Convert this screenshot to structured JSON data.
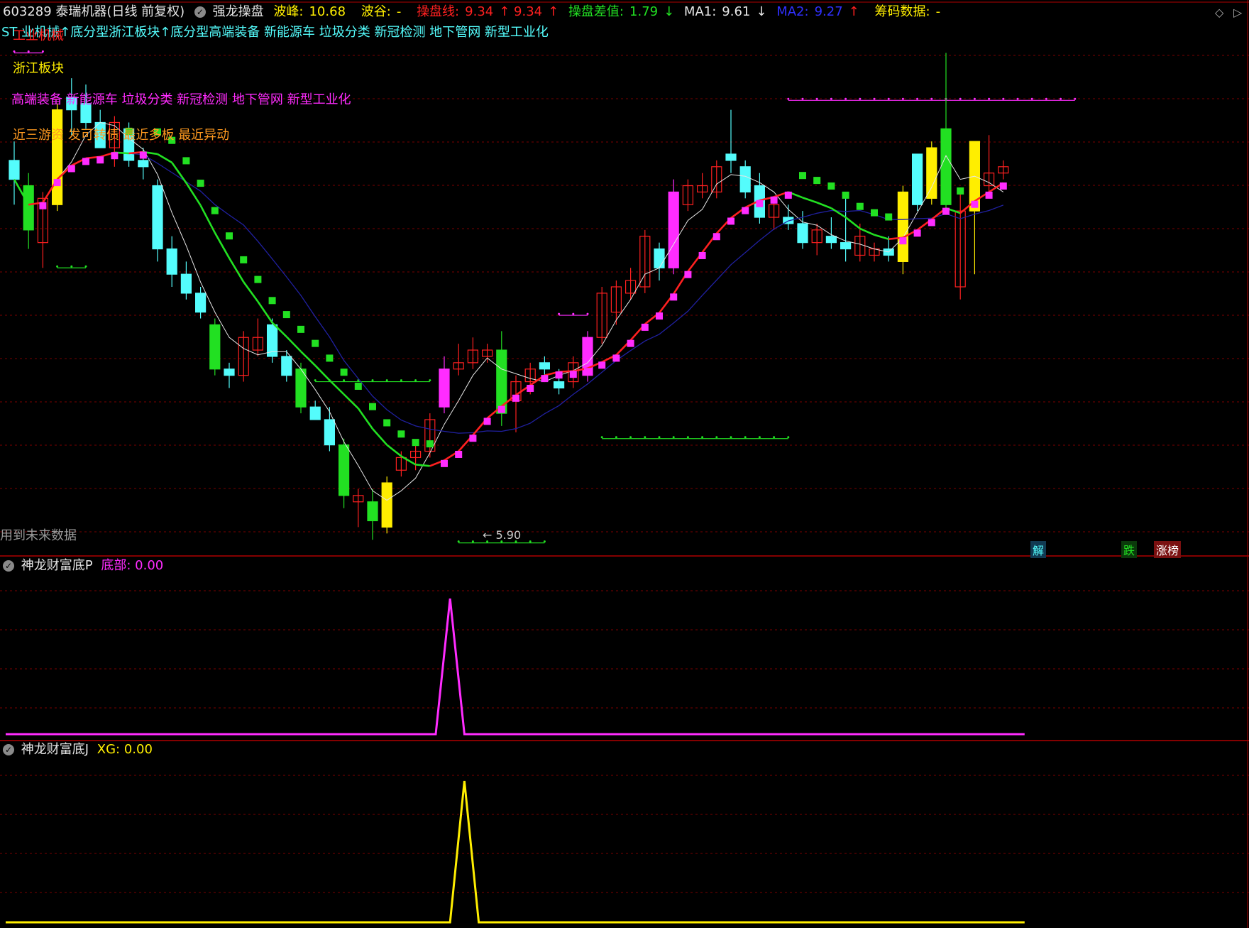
{
  "colors": {
    "bg": "#000000",
    "grid": "#7a0000",
    "divider": "#b00000",
    "cyan": "#54fcfc",
    "green": "#22e022",
    "yellow": "#ffee00",
    "magenta": "#ff2cff",
    "red": "#ff2020",
    "blue": "#2020a0",
    "white": "#e6e6e6",
    "text": "#cccccc"
  },
  "header": {
    "stock": "603289 泰瑞机器(日线 前复权)",
    "indicator": "强龙操盘",
    "peak_label": "波峰:",
    "peak_value": "10.68",
    "trough_label": "波谷:",
    "trough_value": "-",
    "cpx_label": "操盘线:",
    "cpx_value1": "9.34",
    "cpx_value2": "9.34",
    "cpcz_label": "操盘差值:",
    "cpcz_value": "1.79",
    "ma1_label": "MA1:",
    "ma1_value": "9.61",
    "ma2_label": "MA2:",
    "ma2_value": "9.27",
    "chip_label": "筹码数据:",
    "chip_value": "-"
  },
  "concept_line": "ST  业机械↑底分型浙江板块↑底分型高端装备 新能源车 垃圾分类 新冠检测 地下管网 新型工业化",
  "chart_labels": {
    "tag_industry": "工业机械",
    "tag_region": "浙江板块",
    "tag_concepts": "高端装备 新能源车 垃圾分类 新冠检测 地下管网 新型工业化",
    "tag_recent": "近三游资 发可转债 最近多板 最近异动",
    "low_marker": "← 5.90",
    "future_warning": "用到未来数据",
    "marker_jie": "解",
    "marker_die": "跌",
    "marker_zhangbang": "涨榜"
  },
  "panel2": {
    "title": "神龙财富底P",
    "field_label": "底部:",
    "field_value": "0.00"
  },
  "panel3": {
    "title": "神龙财富底J",
    "field_label": "XG:",
    "field_value": "0.00"
  },
  "icons": [
    "collapse-icon",
    "diamond-icon",
    "scroll-right-icon"
  ],
  "chart_data": [
    {
      "type": "candlestick",
      "title": "强龙操盘",
      "candles": [
        {
          "o": 10.0,
          "h": 10.3,
          "l": 9.3,
          "c": 9.7,
          "color": "cyan"
        },
        {
          "o": 9.6,
          "h": 9.8,
          "l": 8.6,
          "c": 8.9,
          "color": "green"
        },
        {
          "o": 8.7,
          "h": 9.5,
          "l": 8.3,
          "c": 9.4,
          "color": "red"
        },
        {
          "o": 9.3,
          "h": 10.9,
          "l": 9.2,
          "c": 10.8,
          "color": "yellow"
        },
        {
          "o": 11.0,
          "h": 11.3,
          "l": 10.4,
          "c": 10.8,
          "color": "cyan"
        },
        {
          "o": 10.9,
          "h": 11.2,
          "l": 10.5,
          "c": 10.6,
          "color": "cyan"
        },
        {
          "o": 10.6,
          "h": 10.8,
          "l": 10.2,
          "c": 10.2,
          "color": "cyan"
        },
        {
          "o": 10.2,
          "h": 10.7,
          "l": 9.9,
          "c": 10.6,
          "color": "red"
        },
        {
          "o": 10.5,
          "h": 10.6,
          "l": 9.9,
          "c": 10.0,
          "color": "cyan"
        },
        {
          "o": 10.0,
          "h": 10.2,
          "l": 9.7,
          "c": 9.9,
          "color": "cyan"
        },
        {
          "o": 9.6,
          "h": 9.7,
          "l": 8.4,
          "c": 8.6,
          "color": "cyan"
        },
        {
          "o": 8.6,
          "h": 8.8,
          "l": 8.0,
          "c": 8.2,
          "color": "cyan"
        },
        {
          "o": 8.2,
          "h": 8.4,
          "l": 7.8,
          "c": 7.9,
          "color": "cyan"
        },
        {
          "o": 7.9,
          "h": 8.0,
          "l": 7.5,
          "c": 7.6,
          "color": "cyan"
        },
        {
          "o": 7.4,
          "h": 7.5,
          "l": 6.6,
          "c": 6.7,
          "color": "green"
        },
        {
          "o": 6.7,
          "h": 6.8,
          "l": 6.4,
          "c": 6.6,
          "color": "cyan"
        },
        {
          "o": 6.6,
          "h": 7.3,
          "l": 6.5,
          "c": 7.2,
          "color": "red"
        },
        {
          "o": 7.0,
          "h": 7.5,
          "l": 6.9,
          "c": 7.2,
          "color": "red"
        },
        {
          "o": 7.4,
          "h": 7.5,
          "l": 6.8,
          "c": 6.9,
          "color": "cyan"
        },
        {
          "o": 6.9,
          "h": 7.0,
          "l": 6.5,
          "c": 6.6,
          "color": "cyan"
        },
        {
          "o": 6.7,
          "h": 6.8,
          "l": 6.0,
          "c": 6.1,
          "color": "green"
        },
        {
          "o": 6.1,
          "h": 6.2,
          "l": 5.9,
          "c": 5.9,
          "color": "cyan"
        },
        {
          "o": 5.9,
          "h": 6.1,
          "l": 5.4,
          "c": 5.5,
          "color": "cyan"
        },
        {
          "o": 5.5,
          "h": 5.6,
          "l": 4.5,
          "c": 4.7,
          "color": "green"
        },
        {
          "o": 4.7,
          "h": 4.8,
          "l": 4.2,
          "c": 4.6,
          "color": "red"
        },
        {
          "o": 4.6,
          "h": 4.8,
          "l": 4.0,
          "c": 4.3,
          "color": "green"
        },
        {
          "o": 4.2,
          "h": 5.0,
          "l": 4.1,
          "c": 4.9,
          "color": "yellow"
        },
        {
          "o": 5.1,
          "h": 5.4,
          "l": 5.0,
          "c": 5.3,
          "color": "red"
        },
        {
          "o": 5.3,
          "h": 5.5,
          "l": 5.1,
          "c": 5.4,
          "color": "red"
        },
        {
          "o": 5.4,
          "h": 6.0,
          "l": 5.3,
          "c": 5.9,
          "color": "red"
        },
        {
          "o": 6.1,
          "h": 6.9,
          "l": 6.0,
          "c": 6.7,
          "color": "magenta"
        },
        {
          "o": 6.7,
          "h": 7.1,
          "l": 6.6,
          "c": 6.8,
          "color": "red"
        },
        {
          "o": 6.8,
          "h": 7.2,
          "l": 6.7,
          "c": 7.0,
          "color": "red"
        },
        {
          "o": 6.9,
          "h": 7.1,
          "l": 6.8,
          "c": 7.0,
          "color": "red"
        },
        {
          "o": 7.0,
          "h": 7.3,
          "l": 5.8,
          "c": 6.0,
          "color": "green"
        },
        {
          "o": 6.2,
          "h": 6.6,
          "l": 5.7,
          "c": 6.5,
          "color": "red"
        },
        {
          "o": 6.5,
          "h": 6.8,
          "l": 6.3,
          "c": 6.7,
          "color": "red"
        },
        {
          "o": 6.7,
          "h": 6.9,
          "l": 6.5,
          "c": 6.8,
          "color": "cyan"
        },
        {
          "o": 6.5,
          "h": 6.7,
          "l": 6.3,
          "c": 6.4,
          "color": "cyan"
        },
        {
          "o": 6.5,
          "h": 6.9,
          "l": 6.4,
          "c": 6.8,
          "color": "red"
        },
        {
          "o": 6.6,
          "h": 7.3,
          "l": 6.5,
          "c": 7.2,
          "color": "magenta"
        },
        {
          "o": 7.2,
          "h": 8.0,
          "l": 7.1,
          "c": 7.9,
          "color": "red"
        },
        {
          "o": 7.6,
          "h": 8.1,
          "l": 7.4,
          "c": 8.0,
          "color": "red"
        },
        {
          "o": 7.9,
          "h": 8.3,
          "l": 7.8,
          "c": 8.1,
          "color": "red"
        },
        {
          "o": 8.0,
          "h": 8.9,
          "l": 7.9,
          "c": 8.8,
          "color": "red"
        },
        {
          "o": 8.6,
          "h": 8.7,
          "l": 8.1,
          "c": 8.3,
          "color": "cyan"
        },
        {
          "o": 8.3,
          "h": 9.7,
          "l": 8.2,
          "c": 9.5,
          "color": "magenta"
        },
        {
          "o": 9.3,
          "h": 9.7,
          "l": 9.2,
          "c": 9.6,
          "color": "red"
        },
        {
          "o": 9.6,
          "h": 9.8,
          "l": 9.4,
          "c": 9.5,
          "color": "red"
        },
        {
          "o": 9.5,
          "h": 10.0,
          "l": 9.4,
          "c": 9.9,
          "color": "red"
        },
        {
          "o": 10.0,
          "h": 10.8,
          "l": 9.8,
          "c": 10.1,
          "color": "cyan"
        },
        {
          "o": 9.9,
          "h": 10.0,
          "l": 9.4,
          "c": 9.5,
          "color": "cyan"
        },
        {
          "o": 9.6,
          "h": 9.8,
          "l": 9.0,
          "c": 9.1,
          "color": "cyan"
        },
        {
          "o": 9.1,
          "h": 9.4,
          "l": 8.9,
          "c": 9.3,
          "color": "red"
        },
        {
          "o": 9.1,
          "h": 9.3,
          "l": 8.9,
          "c": 9.0,
          "color": "cyan"
        },
        {
          "o": 9.0,
          "h": 9.2,
          "l": 8.6,
          "c": 8.7,
          "color": "cyan"
        },
        {
          "o": 8.7,
          "h": 9.0,
          "l": 8.5,
          "c": 8.9,
          "color": "red"
        },
        {
          "o": 8.8,
          "h": 9.1,
          "l": 8.6,
          "c": 8.7,
          "color": "cyan"
        },
        {
          "o": 8.7,
          "h": 9.5,
          "l": 8.4,
          "c": 8.6,
          "color": "cyan"
        },
        {
          "o": 8.8,
          "h": 9.0,
          "l": 8.4,
          "c": 8.5,
          "color": "red"
        },
        {
          "o": 8.5,
          "h": 8.7,
          "l": 8.4,
          "c": 8.6,
          "color": "red"
        },
        {
          "o": 8.6,
          "h": 8.8,
          "l": 8.4,
          "c": 8.5,
          "color": "cyan"
        },
        {
          "o": 8.4,
          "h": 9.6,
          "l": 8.2,
          "c": 9.5,
          "color": "yellow"
        },
        {
          "o": 9.3,
          "h": 10.1,
          "l": 9.2,
          "c": 10.1,
          "color": "cyan"
        },
        {
          "o": 9.4,
          "h": 10.3,
          "l": 9.3,
          "c": 10.2,
          "color": "yellow"
        },
        {
          "o": 9.3,
          "h": 11.7,
          "l": 9.2,
          "c": 10.5,
          "color": "green"
        },
        {
          "o": 9.2,
          "h": 9.5,
          "l": 7.8,
          "c": 8.0,
          "color": "red"
        },
        {
          "o": 9.2,
          "h": 10.3,
          "l": 8.2,
          "c": 10.3,
          "color": "yellow"
        },
        {
          "o": 9.6,
          "h": 10.4,
          "l": 9.5,
          "c": 9.8,
          "color": "red"
        },
        {
          "o": 9.8,
          "h": 10.0,
          "l": 9.7,
          "c": 9.9,
          "color": "red"
        }
      ],
      "ma1_label": "MA1",
      "ma2_label": "MA2",
      "ylim": [
        3.8,
        12.2
      ],
      "low_price": 5.9
    },
    {
      "type": "line",
      "title": "神龙财富底P",
      "series": [
        {
          "name": "底部",
          "values_spike_index": 26,
          "peak": 1,
          "base": 0
        }
      ]
    },
    {
      "type": "line",
      "title": "神龙财富底J",
      "series": [
        {
          "name": "XG",
          "values_spike_index": 27,
          "peak": 1,
          "base": 0
        }
      ]
    }
  ]
}
